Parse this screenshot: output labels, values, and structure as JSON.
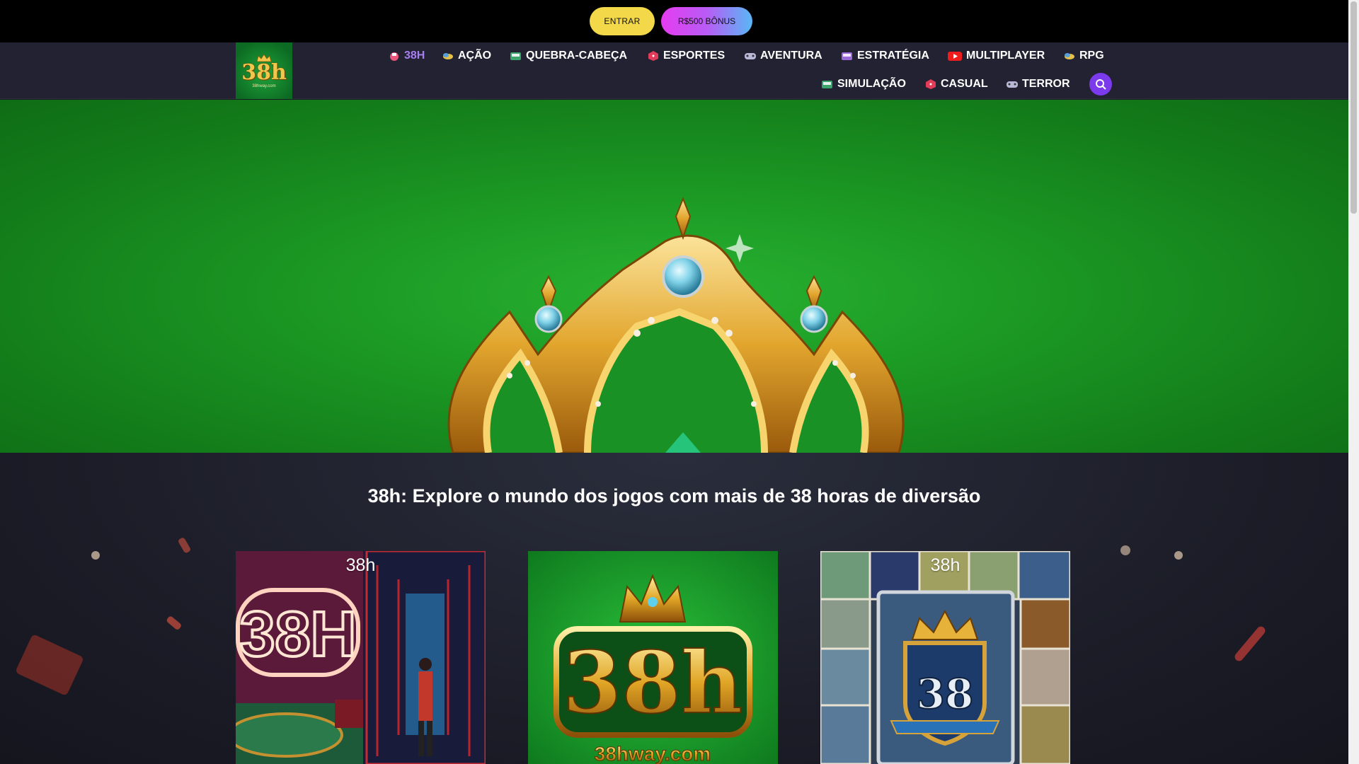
{
  "topbar": {
    "login_label": "ENTRAR",
    "bonus_label": "R$500 BÔNUS"
  },
  "logo": {
    "text": "38h",
    "url_text": "38hway.com"
  },
  "nav": {
    "items": [
      {
        "label": "38H",
        "icon": "casino-icon",
        "active": true
      },
      {
        "label": "AÇÃO",
        "icon": "coins-icon"
      },
      {
        "label": "QUEBRA-CABEÇA",
        "icon": "slot-machine-icon"
      },
      {
        "label": "ESPORTES",
        "icon": "dice-icon"
      },
      {
        "label": "AVENTURA",
        "icon": "gamepad-icon"
      },
      {
        "label": "ESTRATÉGIA",
        "icon": "slot-machine-icon"
      },
      {
        "label": "MULTIPLAYER",
        "icon": "video-icon"
      },
      {
        "label": "RPG",
        "icon": "coins-icon"
      },
      {
        "label": "SIMULAÇÃO",
        "icon": "slot-machine-icon"
      },
      {
        "label": "CASUAL",
        "icon": "dice-icon"
      },
      {
        "label": "TERROR",
        "icon": "gamepad-icon"
      }
    ],
    "search_icon": "search-icon"
  },
  "main": {
    "headline": "38h: Explore o mundo dos jogos com mais de 38 horas de diversão",
    "cards": [
      {
        "label": "38h",
        "image_text": "38H"
      },
      {
        "label": "",
        "image_text": "38h",
        "image_subtext": "38hway.com"
      },
      {
        "label": "38h",
        "image_text": "38"
      }
    ]
  },
  "colors": {
    "accent": "#7c3aed",
    "login_button": "#f3d849",
    "hero_green": "#1c9a24",
    "nav_bg": "#222232"
  }
}
